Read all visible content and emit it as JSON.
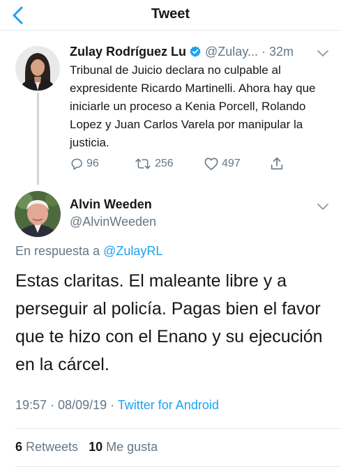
{
  "header": {
    "back_icon": "chevron-left-icon",
    "title": "Tweet"
  },
  "colors": {
    "accent": "#1da1f2",
    "text": "#14171a",
    "muted": "#657786",
    "border": "#e1e8ed"
  },
  "parent_tweet": {
    "author_name": "Zulay Rodríguez Lu",
    "verified_icon": "verified-badge-icon",
    "handle": "@Zulay... · 32m",
    "text": "Tribunal de Juicio declara no culpable al expresidente Ricardo Martinelli. Ahora hay que iniciarle un proceso a Kenia Porcell, Rolando Lopez y Juan Carlos Varela por manipular la justicia.",
    "actions": {
      "replies": "96",
      "retweets": "256",
      "likes": "497"
    }
  },
  "tweet": {
    "author_name": "Alvin Weeden",
    "handle": "@AlvinWeeden",
    "reply_prefix": "En respuesta a ",
    "reply_mention": "@ZulayRL",
    "text": "Estas claritas. El maleante libre y a perseguir al policía. Pagas bien el favor que te hizo con el Enano y su ejecución en la cárcel.",
    "time_date": "19:57 · 08/09/19 · ",
    "source": "Twitter for Android",
    "stats": {
      "retweets_count": "6",
      "retweets_label": " Retweets",
      "likes_count": "10",
      "likes_label": " Me gusta"
    }
  }
}
